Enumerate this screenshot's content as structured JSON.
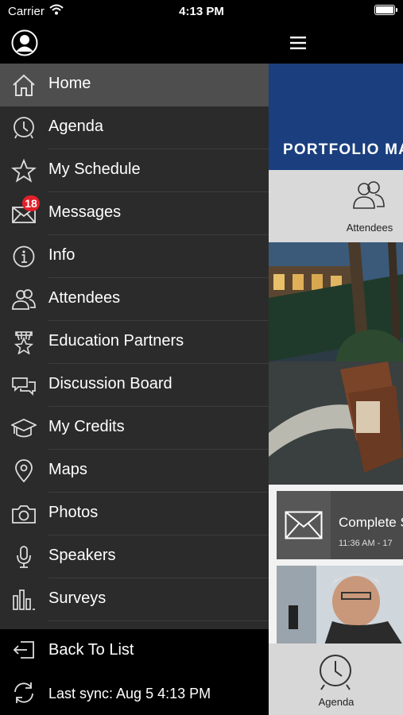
{
  "status_bar": {
    "carrier": "Carrier",
    "time": "4:13 PM"
  },
  "drawer": {
    "items": [
      {
        "label": "Home",
        "icon": "home-icon",
        "active": true
      },
      {
        "label": "Agenda",
        "icon": "clock-icon"
      },
      {
        "label": "My Schedule",
        "icon": "star-icon"
      },
      {
        "label": "Messages",
        "icon": "envelope-icon",
        "badge": "18"
      },
      {
        "label": "Info",
        "icon": "info-icon"
      },
      {
        "label": "Attendees",
        "icon": "people-icon"
      },
      {
        "label": "Education Partners",
        "icon": "award-icon"
      },
      {
        "label": "Discussion Board",
        "icon": "chat-bubbles-icon"
      },
      {
        "label": "My Credits",
        "icon": "graduation-cap-icon"
      },
      {
        "label": "Maps",
        "icon": "map-pin-icon"
      },
      {
        "label": "Photos",
        "icon": "camera-icon"
      },
      {
        "label": "Speakers",
        "icon": "microphone-icon"
      },
      {
        "label": "Surveys",
        "icon": "bar-chart-icon"
      }
    ],
    "back_to_list": "Back To List",
    "last_sync": "Last sync:  Aug 5 4:13 PM"
  },
  "content": {
    "banner_title": "PORTFOLIO MA",
    "attendees_tile": "Attendees",
    "card_title": "Complete S",
    "card_time": "11:36 AM - 17",
    "agenda_tile": "Agenda"
  },
  "colors": {
    "drawer_bg": "#2b2b2b",
    "active_item": "#4e4e4e",
    "badge": "#e2202a",
    "banner": "#1b3f7e"
  }
}
